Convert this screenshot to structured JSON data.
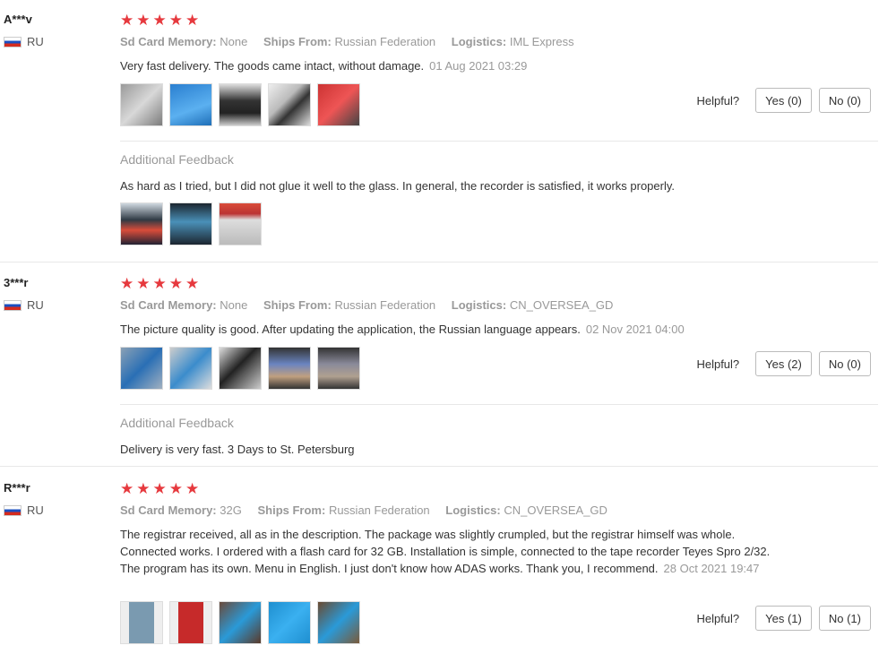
{
  "helpful_label": "Helpful?",
  "additional_feedback_label": "Additional Feedback",
  "meta_labels": {
    "sd": "Sd Card Memory:",
    "ships": "Ships From:",
    "logistics": "Logistics:"
  },
  "stars": "★★★★★",
  "reviews": [
    {
      "user": "A***v",
      "country": "RU",
      "sd": "None",
      "ships": "Russian Federation",
      "logistics": "IML Express",
      "text": "Very fast delivery. The goods came intact, without damage.",
      "date": "01 Aug 2021 03:29",
      "yes": "Yes (0)",
      "no": "No (0)",
      "additional": "As hard as I tried, but I did not glue it well to the glass. In general, the recorder is satisfied, it works properly."
    },
    {
      "user": "3***r",
      "country": "RU",
      "sd": "None",
      "ships": "Russian Federation",
      "logistics": "CN_OVERSEA_GD",
      "text": "The picture quality is good. After updating the application, the Russian language appears.",
      "date": "02 Nov 2021 04:00",
      "yes": "Yes (2)",
      "no": "No (0)",
      "additional": "Delivery is very fast. 3 Days to St. Petersburg"
    },
    {
      "user": "R***r",
      "country": "RU",
      "sd": "32G",
      "ships": "Russian Federation",
      "logistics": "CN_OVERSEA_GD",
      "text": "The registrar received, all as in the description. The package was slightly crumpled, but the registrar himself was whole. Connected works. I ordered with a flash card for 32 GB. Installation is simple, connected to the tape recorder Teyes Spro 2/32. The program has its own. Menu in English. I just don't know how ADAS works. Thank you, I recommend.",
      "date": "28 Oct 2021 19:47",
      "yes": "Yes (1)",
      "no": "No (1)"
    }
  ]
}
